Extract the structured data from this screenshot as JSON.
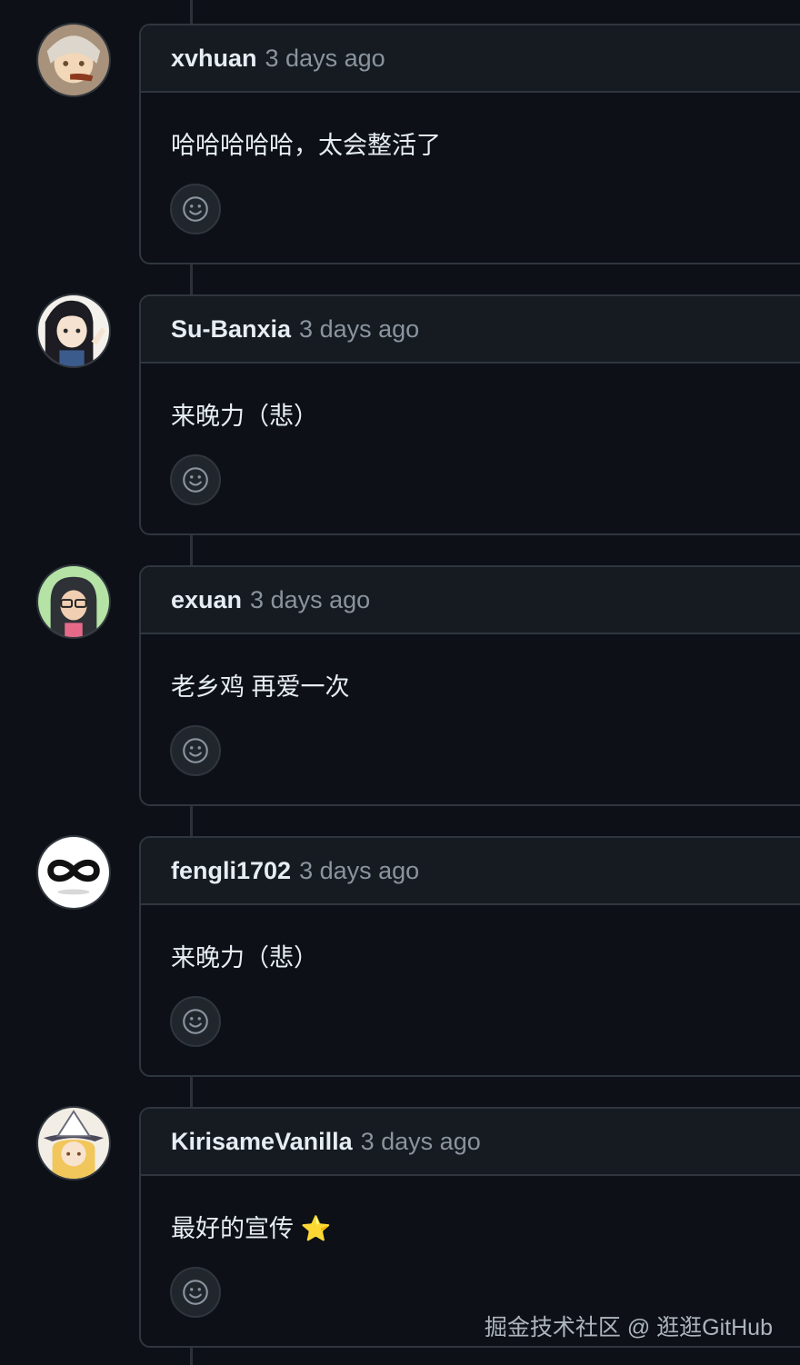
{
  "comments": [
    {
      "author": "xvhuan",
      "time": "3 days ago",
      "body": "哈哈哈哈哈，太会整活了",
      "avatar_icon": "avatar-anime-icon"
    },
    {
      "author": "Su-Banxia",
      "time": "3 days ago",
      "body": "来晚力（悲）",
      "avatar_icon": "avatar-anime-girl-icon"
    },
    {
      "author": "exuan",
      "time": "3 days ago",
      "body": "老乡鸡 再爱一次",
      "avatar_icon": "avatar-hooded-person-icon"
    },
    {
      "author": "fengli1702",
      "time": "3 days ago",
      "body": "来晚力（悲）",
      "avatar_icon": "avatar-infinity-icon"
    },
    {
      "author": "KirisameVanilla",
      "time": "3 days ago",
      "body": "最好的宣传 ⭐",
      "avatar_icon": "avatar-witch-icon"
    }
  ],
  "reaction_icon": "smiley-icon",
  "watermark": "掘金技术社区 @ 逛逛GitHub"
}
